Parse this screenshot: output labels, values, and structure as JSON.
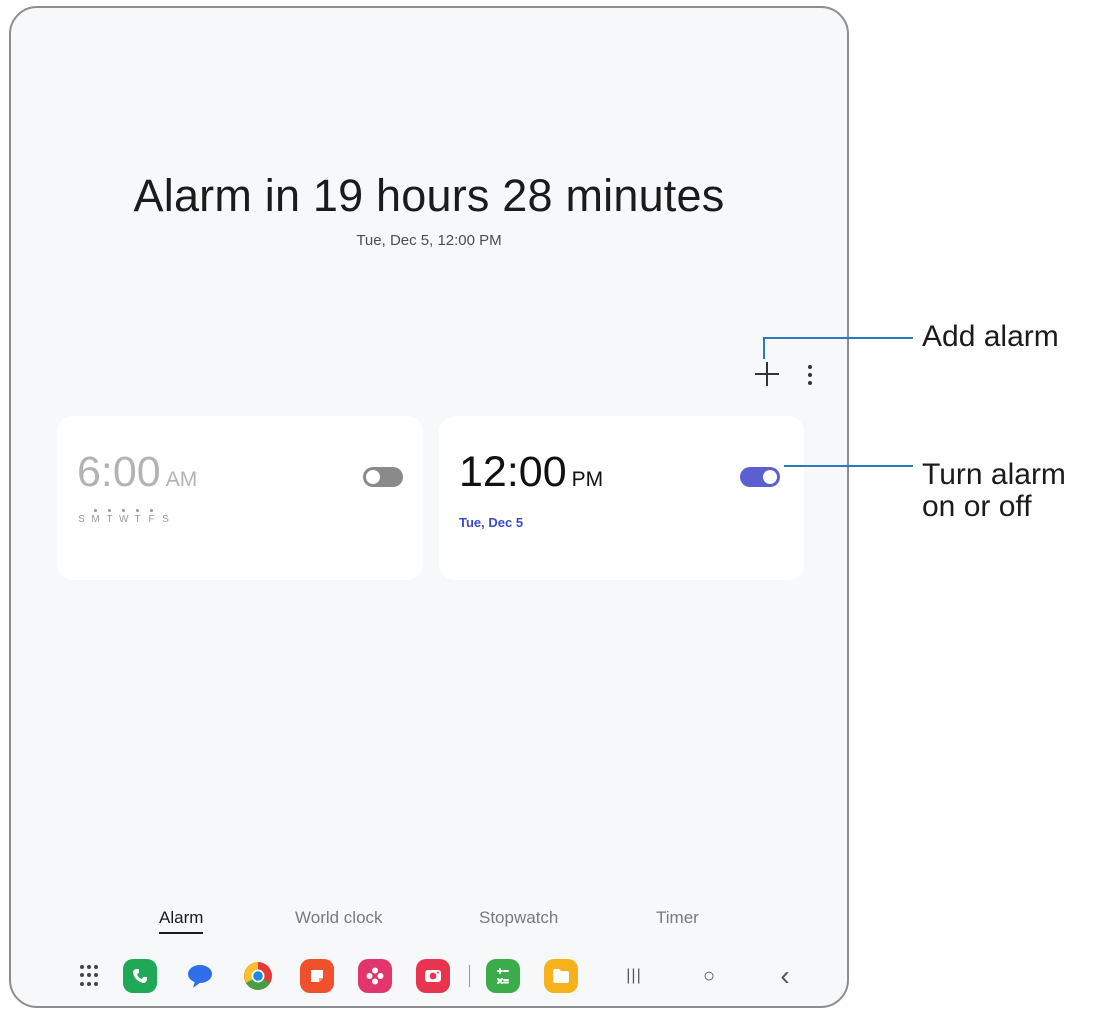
{
  "header": {
    "title": "Alarm in 19 hours 28 minutes",
    "subtitle": "Tue, Dec 5, 12:00 PM"
  },
  "toolbar": {
    "add_icon": "plus-icon",
    "more_icon": "more-vertical-icon"
  },
  "alarms": [
    {
      "time": "6:00",
      "ampm": "AM",
      "days": [
        "S",
        "M",
        "T",
        "W",
        "T",
        "F",
        "S"
      ],
      "enabled": false
    },
    {
      "time": "12:00",
      "ampm": "PM",
      "date": "Tue, Dec 5",
      "enabled": true
    }
  ],
  "tabs": [
    {
      "label": "Alarm",
      "active": true
    },
    {
      "label": "World clock",
      "active": false
    },
    {
      "label": "Stopwatch",
      "active": false
    },
    {
      "label": "Timer",
      "active": false
    }
  ],
  "dock": {
    "apps": [
      "apps-grid-icon",
      "phone-icon",
      "messages-icon",
      "chrome-icon",
      "notes-icon",
      "gallery-icon",
      "camera-icon",
      "calculator-icon",
      "files-icon"
    ],
    "nav": {
      "recents": "|||",
      "home": "○",
      "back": "‹"
    }
  },
  "callouts": {
    "add_alarm": "Add alarm",
    "toggle_line1": "Turn alarm",
    "toggle_line2": "on or off"
  },
  "colors": {
    "accent": "#5a5fd1",
    "date_text": "#3b4bcf",
    "callout_line": "#2a7ac0"
  }
}
